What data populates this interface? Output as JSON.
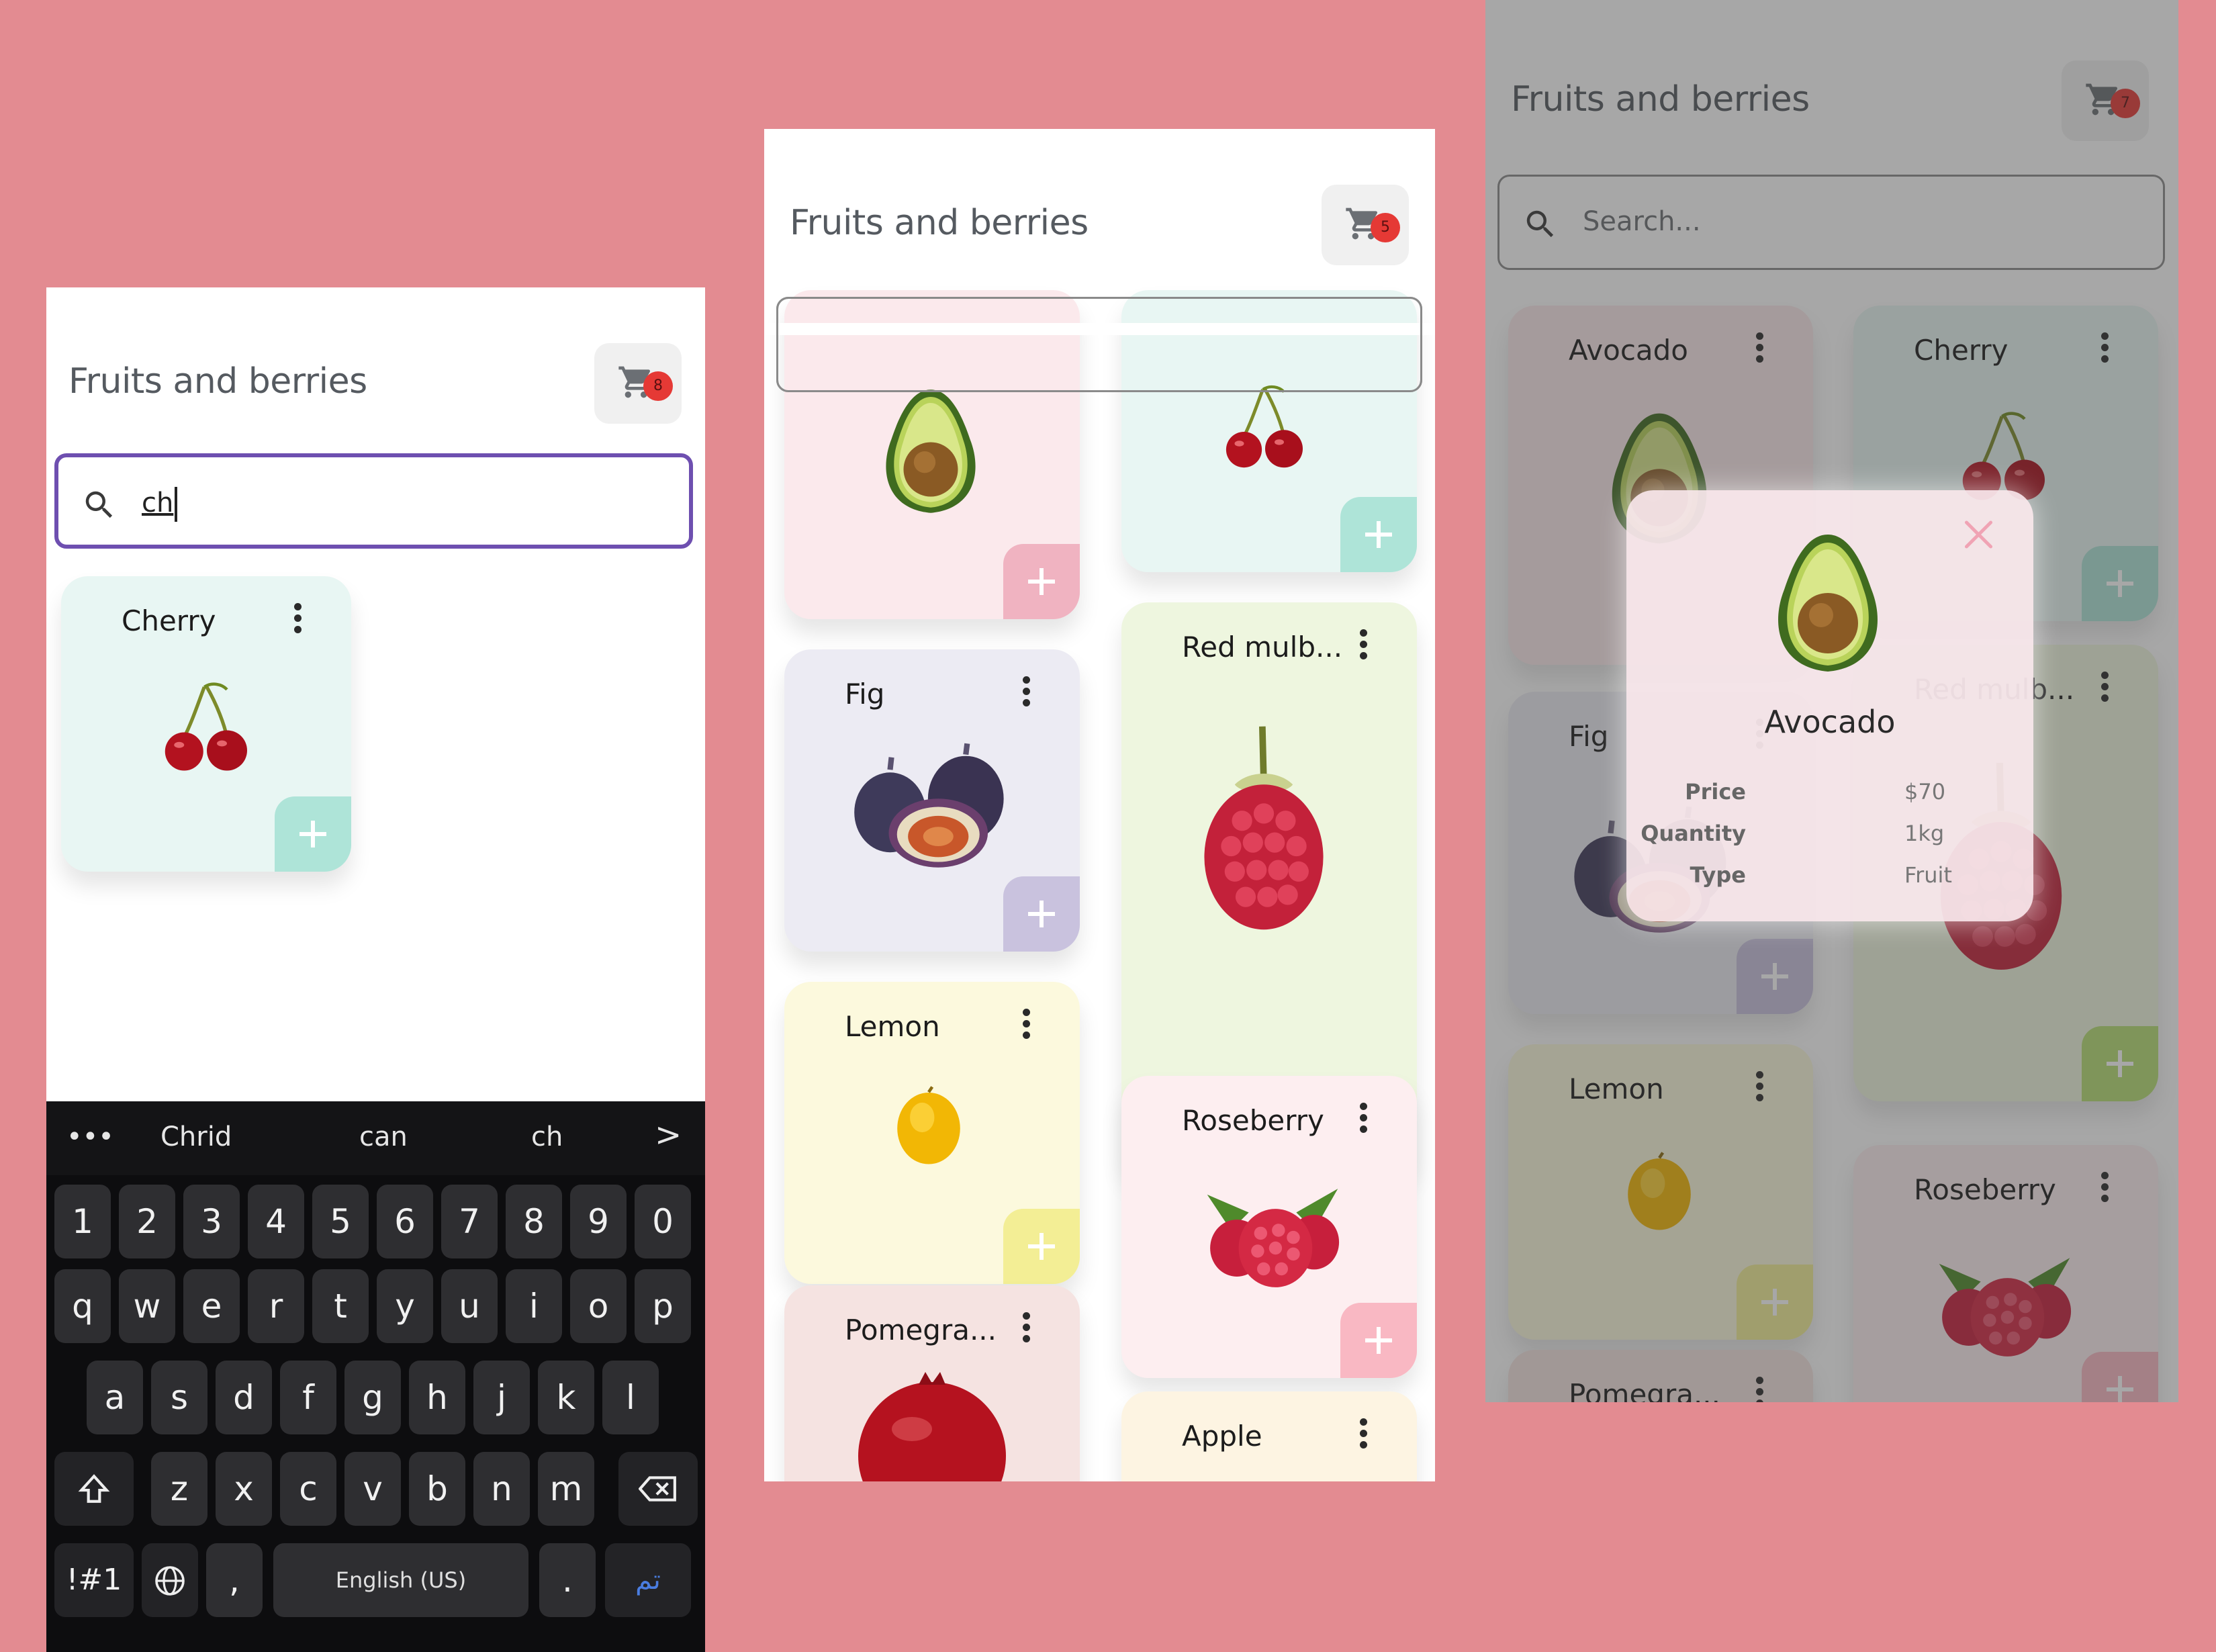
{
  "app": {
    "title": "Fruits and berries",
    "search_placeholder": "Search...",
    "add_symbol": "+"
  },
  "screen1": {
    "cart_count": "8",
    "search_value": "ch",
    "cards": [
      {
        "name": "Cherry"
      }
    ],
    "keyboard": {
      "more_label": "•••",
      "suggestions": [
        "Chrid",
        "can",
        "ch"
      ],
      "next_label": ">",
      "row_numbers": [
        "1",
        "2",
        "3",
        "4",
        "5",
        "6",
        "7",
        "8",
        "9",
        "0"
      ],
      "row_q": [
        "q",
        "w",
        "e",
        "r",
        "t",
        "y",
        "u",
        "i",
        "o",
        "p"
      ],
      "row_a": [
        "a",
        "s",
        "d",
        "f",
        "g",
        "h",
        "j",
        "k",
        "l"
      ],
      "row_z": [
        "z",
        "x",
        "c",
        "v",
        "b",
        "n",
        "m"
      ],
      "symbols_label": "!#1",
      "comma_label": ",",
      "space_label": "English (US)",
      "period_label": ".",
      "enter_label": "تم"
    }
  },
  "screen2": {
    "cart_count": "5",
    "cards": [
      {
        "name": "Fig"
      },
      {
        "name": "Red mulb..."
      },
      {
        "name": "Lemon"
      },
      {
        "name": "Roseberry"
      },
      {
        "name": "Pomegra..."
      },
      {
        "name": "Apple"
      }
    ]
  },
  "screen3": {
    "cart_count": "7",
    "cards": [
      {
        "name": "Avocado"
      },
      {
        "name": "Cherry"
      },
      {
        "name": "Red mulb..."
      },
      {
        "name": "Fig"
      },
      {
        "name": "Lemon"
      },
      {
        "name": "Roseberry"
      },
      {
        "name": "Pomegra..."
      }
    ],
    "modal": {
      "title": "Avocado",
      "rows": [
        {
          "label": "Price",
          "value": "$70"
        },
        {
          "label": "Quantity",
          "value": "1kg"
        },
        {
          "label": "Type",
          "value": "Fruit"
        }
      ]
    }
  },
  "colors": {
    "background": "#e38b91",
    "accent_focus": "#6e4fb0",
    "badge": "#e53935"
  },
  "icons": [
    "cart-icon",
    "search-icon",
    "more-vert-icon",
    "plus-icon",
    "close-icon",
    "shift-icon",
    "backspace-icon",
    "globe-icon"
  ]
}
